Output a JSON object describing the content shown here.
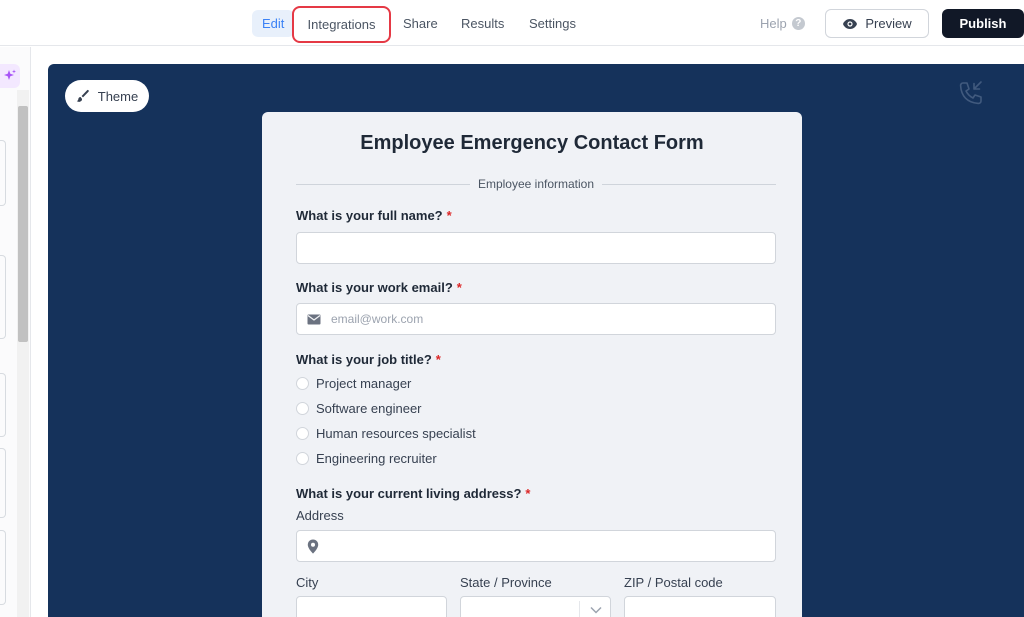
{
  "header": {
    "tabs": [
      {
        "label": "Edit",
        "state": "active"
      },
      {
        "label": "Integrations",
        "state": "highlighted"
      },
      {
        "label": "Share"
      },
      {
        "label": "Results"
      },
      {
        "label": "Settings"
      }
    ],
    "help_label": "Help",
    "help_icon": "?",
    "preview_label": "Preview",
    "publish_label": "Publish"
  },
  "canvas": {
    "theme_label": "Theme",
    "background_color": "#15325b"
  },
  "form": {
    "title": "Employee Emergency Contact Form",
    "section_label": "Employee information",
    "required_marker": "*",
    "questions": {
      "full_name": {
        "label": "What is your full name?"
      },
      "work_email": {
        "label": "What is your work email?",
        "placeholder": "email@work.com"
      },
      "job_title": {
        "label": "What is your job title?",
        "options": [
          "Project manager",
          "Software engineer",
          "Human resources specialist",
          "Engineering recruiter"
        ]
      },
      "address": {
        "label": "What is your current living address?",
        "address_label": "Address",
        "city_label": "City",
        "state_label": "State / Province",
        "zip_label": "ZIP / Postal code"
      }
    }
  },
  "colors": {
    "accent": "#3b82f6",
    "highlight_border": "#e53945",
    "required": "#dc2626",
    "publish_bg": "#111827"
  }
}
